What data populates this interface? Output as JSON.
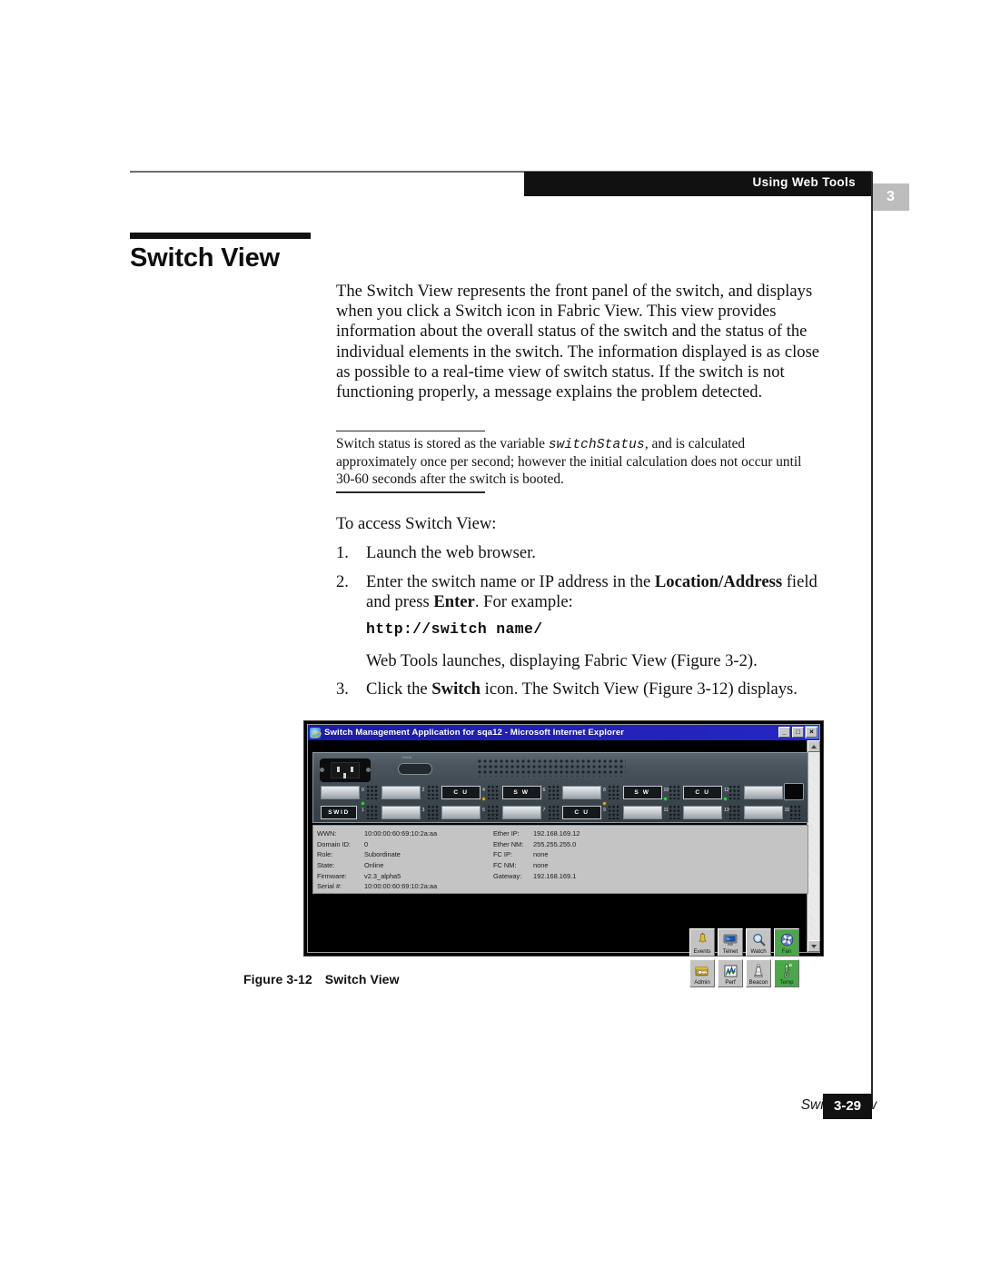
{
  "header": {
    "running_head": "Using Web Tools",
    "chapter_tab": "3"
  },
  "section": {
    "title": "Switch View"
  },
  "intro": {
    "paragraph": "The Switch View represents the front panel of the switch, and displays when you click a Switch icon in Fabric View. This view provides information about the overall status of the switch and the status of the individual elements in the switch. The information displayed is as close as possible to a real-time view of switch status. If the switch is not functioning properly, a message explains the problem detected."
  },
  "note": {
    "before_variable": "Switch status is stored as the variable ",
    "variable": "switchStatus",
    "after_variable": ", and is calculated approximately once per second; however the initial calculation does not occur until 30-60 seconds after the switch is booted."
  },
  "procedure": {
    "lead_in": "To access Switch View:",
    "steps": [
      {
        "number": "1.",
        "text": "Launch the web browser."
      },
      {
        "number": "2.",
        "text_part1": "Enter the switch name or IP address in the ",
        "bold1": "Location/Address",
        "text_part2": " field and press ",
        "bold2": "Enter",
        "text_part3": ". For example:",
        "code": "http://switch name/",
        "result": "Web Tools launches, displaying Fabric View (Figure 3-2)."
      },
      {
        "number": "3.",
        "text_part1": "Click the ",
        "bold1": "Switch",
        "text_part2": " icon. The Switch View (Figure 3-12) displays."
      }
    ]
  },
  "figure": {
    "window": {
      "title": "Switch Management Application for sqa12 - Microsoft Internet Explorer",
      "minimize_label": "_",
      "maximize_label": "□",
      "close_label": "×"
    },
    "switch_panel": {
      "serial_port_label": "Serial",
      "top_ports": [
        {
          "number": "0",
          "type": "blank",
          "label": "",
          "led": "none"
        },
        {
          "number": "2",
          "type": "blank",
          "label": "",
          "led": "none"
        },
        {
          "number": "4",
          "type": "module",
          "label": "C U",
          "led": "amber"
        },
        {
          "number": "6",
          "type": "module",
          "label": "S W",
          "led": "none"
        },
        {
          "number": "8",
          "type": "blank",
          "label": "",
          "led": "none"
        },
        {
          "number": "10",
          "type": "module",
          "label": "S W",
          "led": "green"
        },
        {
          "number": "12",
          "type": "module",
          "label": "C U",
          "led": "green"
        },
        {
          "number": "14",
          "type": "blank",
          "label": "",
          "led": "green"
        }
      ],
      "bottom_ports": [
        {
          "number": "1",
          "type": "module",
          "label": "SWID",
          "led": "green"
        },
        {
          "number": "3",
          "type": "blank",
          "label": "",
          "led": "none"
        },
        {
          "number": "5",
          "type": "blank",
          "label": "",
          "led": "none"
        },
        {
          "number": "7",
          "type": "blank",
          "label": "",
          "led": "none"
        },
        {
          "number": "9",
          "type": "module",
          "label": "C U",
          "led": "amber"
        },
        {
          "number": "11",
          "type": "blank",
          "label": "",
          "led": "none"
        },
        {
          "number": "13",
          "type": "blank",
          "label": "",
          "led": "none"
        },
        {
          "number": "15",
          "type": "blank",
          "label": "",
          "led": "none"
        }
      ]
    },
    "info_left": [
      {
        "key": "WWN:",
        "value": "10:00:00:60:69:10:2a:aa"
      },
      {
        "key": "Domain ID:",
        "value": "0"
      },
      {
        "key": "Role:",
        "value": "Subordinate"
      },
      {
        "key": "State:",
        "value": "Online"
      },
      {
        "key": "Firmware:",
        "value": "v2.3_alpha5"
      },
      {
        "key": "Serial #:",
        "value": "10:00:00:60:69:10:2a:aa"
      }
    ],
    "info_right": [
      {
        "key": "Ether IP:",
        "value": "192.168.169.12"
      },
      {
        "key": "Ether NM:",
        "value": "255.255.255.0"
      },
      {
        "key": "FC IP:",
        "value": "none"
      },
      {
        "key": "FC NM:",
        "value": "none"
      },
      {
        "key": "Gateway:",
        "value": "192.168.169.1"
      }
    ],
    "toolbar_row1": [
      {
        "label": "Events",
        "icon": "bell-icon",
        "state": "normal"
      },
      {
        "label": "Telnet",
        "icon": "monitor-icon",
        "state": "normal"
      },
      {
        "label": "Watch",
        "icon": "magnifier-icon",
        "state": "normal"
      },
      {
        "label": "Fan",
        "icon": "fan-icon",
        "state": "healthy"
      }
    ],
    "toolbar_row2": [
      {
        "label": "Admin",
        "icon": "key-icon",
        "state": "normal"
      },
      {
        "label": "Perf",
        "icon": "chart-icon",
        "state": "normal"
      },
      {
        "label": "Beacon",
        "icon": "beacon-icon",
        "state": "normal"
      },
      {
        "label": "Temp",
        "icon": "thermometer-icon",
        "state": "healthy"
      }
    ],
    "caption_number": "Figure 3-12",
    "caption_text": "Switch View"
  },
  "footer": {
    "section_name": "Switch View",
    "page_number": "3-29"
  },
  "colors": {
    "header_band": "#111111",
    "chapter_tab": "#bdbdbd",
    "titlebar": "#2222b8",
    "healthy_green": "#4aa84a",
    "led_green": "#2fe02f",
    "led_amber": "#f0a818"
  }
}
